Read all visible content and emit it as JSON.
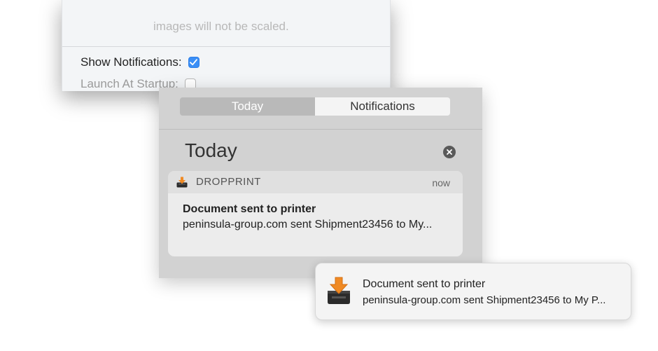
{
  "preferences": {
    "faded_text": "images will not be scaled.",
    "show_notifications_label": "Show Notifications:",
    "show_notifications_checked": true,
    "launch_at_startup_label": "Launch At Startup:",
    "launch_at_startup_checked": false
  },
  "notification_center": {
    "tabs": [
      {
        "label": "Today",
        "active": true
      },
      {
        "label": "Notifications",
        "active": false
      }
    ],
    "section_title": "Today",
    "clear_icon": "close-circle-icon",
    "notification": {
      "app_icon": "tray-download-icon",
      "app_name": "DROPPRINT",
      "time": "now",
      "title": "Document sent to printer",
      "body": "peninsula-group.com sent Shipment23456 to My..."
    }
  },
  "banner": {
    "icon": "tray-download-icon",
    "title": "Document sent to printer",
    "body": "peninsula-group.com sent Shipment23456 to My P..."
  },
  "colors": {
    "accent": "#3a8ef6",
    "icon_orange": "#f08a24",
    "icon_tray": "#2b2b2b"
  }
}
